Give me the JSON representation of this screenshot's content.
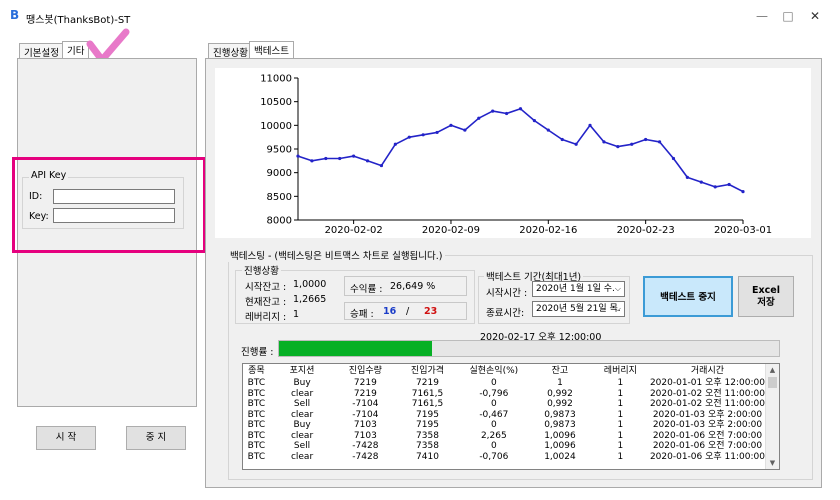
{
  "window": {
    "title": "땡스봇(ThanksBot)-ST",
    "icon_glyph": "B",
    "buttons": [
      "—",
      "□",
      "✕"
    ]
  },
  "left": {
    "tabs": [
      "기본설정",
      "기타"
    ],
    "api_group_label": "API Key",
    "id_label": "ID:",
    "key_label": "Key:",
    "id_value": "",
    "key_value": "",
    "start_button": "시 작",
    "stop_button": "중 지"
  },
  "right": {
    "tabs": [
      "진행상황",
      "백테스트"
    ]
  },
  "chart_data": {
    "type": "line",
    "y_ticks": [
      8000,
      8500,
      9000,
      9500,
      10000,
      10500,
      11000
    ],
    "ylim": [
      8000,
      11000
    ],
    "x_ticks": [
      "2020-02-02",
      "2020-02-09",
      "2020-02-16",
      "2020-02-23",
      "2020-03-01"
    ],
    "x": [
      "2020-01-29",
      "2020-01-30",
      "2020-01-31",
      "2020-02-01",
      "2020-02-02",
      "2020-02-03",
      "2020-02-04",
      "2020-02-05",
      "2020-02-06",
      "2020-02-07",
      "2020-02-08",
      "2020-02-09",
      "2020-02-10",
      "2020-02-11",
      "2020-02-12",
      "2020-02-13",
      "2020-02-14",
      "2020-02-15",
      "2020-02-16",
      "2020-02-17",
      "2020-02-18",
      "2020-02-19",
      "2020-02-20",
      "2020-02-21",
      "2020-02-22",
      "2020-02-23",
      "2020-02-24",
      "2020-02-25",
      "2020-02-26",
      "2020-02-27",
      "2020-02-28",
      "2020-02-29",
      "2020-03-01"
    ],
    "values": [
      9350,
      9250,
      9300,
      9300,
      9350,
      9250,
      9150,
      9600,
      9750,
      9800,
      9850,
      10000,
      9900,
      10150,
      10300,
      10250,
      10350,
      10100,
      9900,
      9700,
      9600,
      10000,
      9650,
      9550,
      9600,
      9700,
      9650,
      9300,
      8900,
      8800,
      8700,
      8750,
      8600
    ],
    "series_color": "#2323c8"
  },
  "backtest": {
    "group_title": "백테스팅 - (백테스팅은 비트맥스 차트로 실행됩니다.)",
    "progress_group_title": "진행상황",
    "start_balance_label": "시작잔고 :",
    "start_balance": "1,0000",
    "current_balance_label": "현재잔고 :",
    "current_balance": "1,2665",
    "leverage_label": "레버리지 :",
    "leverage": "1",
    "profit_label": "수익률 :",
    "profit": "26,649 %",
    "winloss_label": "승패 :",
    "wins": "16",
    "slash": "/",
    "losses": "23",
    "wins_color": "#1a3cc8",
    "losses_color": "#d01010",
    "period_group_title": "백테스트 기간(최대1년)",
    "start_time_label": "시작시간 :",
    "start_time": "2020년   1월   1일 수.",
    "end_time_label": "종료시간:",
    "end_time": "2020년   5월 21일 목.",
    "stop_backtest_button": "백테스트 중지",
    "excel_button_line1": "Excel",
    "excel_button_line2": "저장",
    "current_time": "2020-02-17 오후 12:00:00",
    "progress_label": "진행률 :",
    "progress_fraction": 0.305,
    "progress_color": "#06b025"
  },
  "trades": {
    "headers": [
      "종목",
      "포지션",
      "진입수량",
      "진입가격",
      "실현손익(%)",
      "잔고",
      "레버리지",
      "거래시간"
    ],
    "rows": [
      [
        "BTC",
        "Buy",
        "7219",
        "7219",
        "0",
        "1",
        "1",
        "2020-01-01 오후 12:00:00"
      ],
      [
        "BTC",
        "clear",
        "7219",
        "7161,5",
        "-0,796",
        "0,992",
        "1",
        "2020-01-02 오전 11:00:00"
      ],
      [
        "BTC",
        "Sell",
        "-7104",
        "7161,5",
        "0",
        "0,992",
        "1",
        "2020-01-02 오전 11:00:00"
      ],
      [
        "BTC",
        "clear",
        "-7104",
        "7195",
        "-0,467",
        "0,9873",
        "1",
        "2020-01-03 오후 2:00:00"
      ],
      [
        "BTC",
        "Buy",
        "7103",
        "7195",
        "0",
        "0,9873",
        "1",
        "2020-01-03 오후 2:00:00"
      ],
      [
        "BTC",
        "clear",
        "7103",
        "7358",
        "2,265",
        "1,0096",
        "1",
        "2020-01-06 오전 7:00:00"
      ],
      [
        "BTC",
        "Sell",
        "-7428",
        "7358",
        "0",
        "1,0096",
        "1",
        "2020-01-06 오전 7:00:00"
      ],
      [
        "BTC",
        "clear",
        "-7428",
        "7410",
        "-0,706",
        "1,0024",
        "1",
        "2020-01-06 오후 11:00:00"
      ]
    ],
    "scroll_up": "▲",
    "scroll_down": "▼"
  },
  "colors": {
    "annotation_magenta": "#e5007e",
    "checkmark_pink": "#e879c9",
    "stop_button_bg": "#c9e8fb",
    "stop_button_border": "#3c9bd6"
  }
}
